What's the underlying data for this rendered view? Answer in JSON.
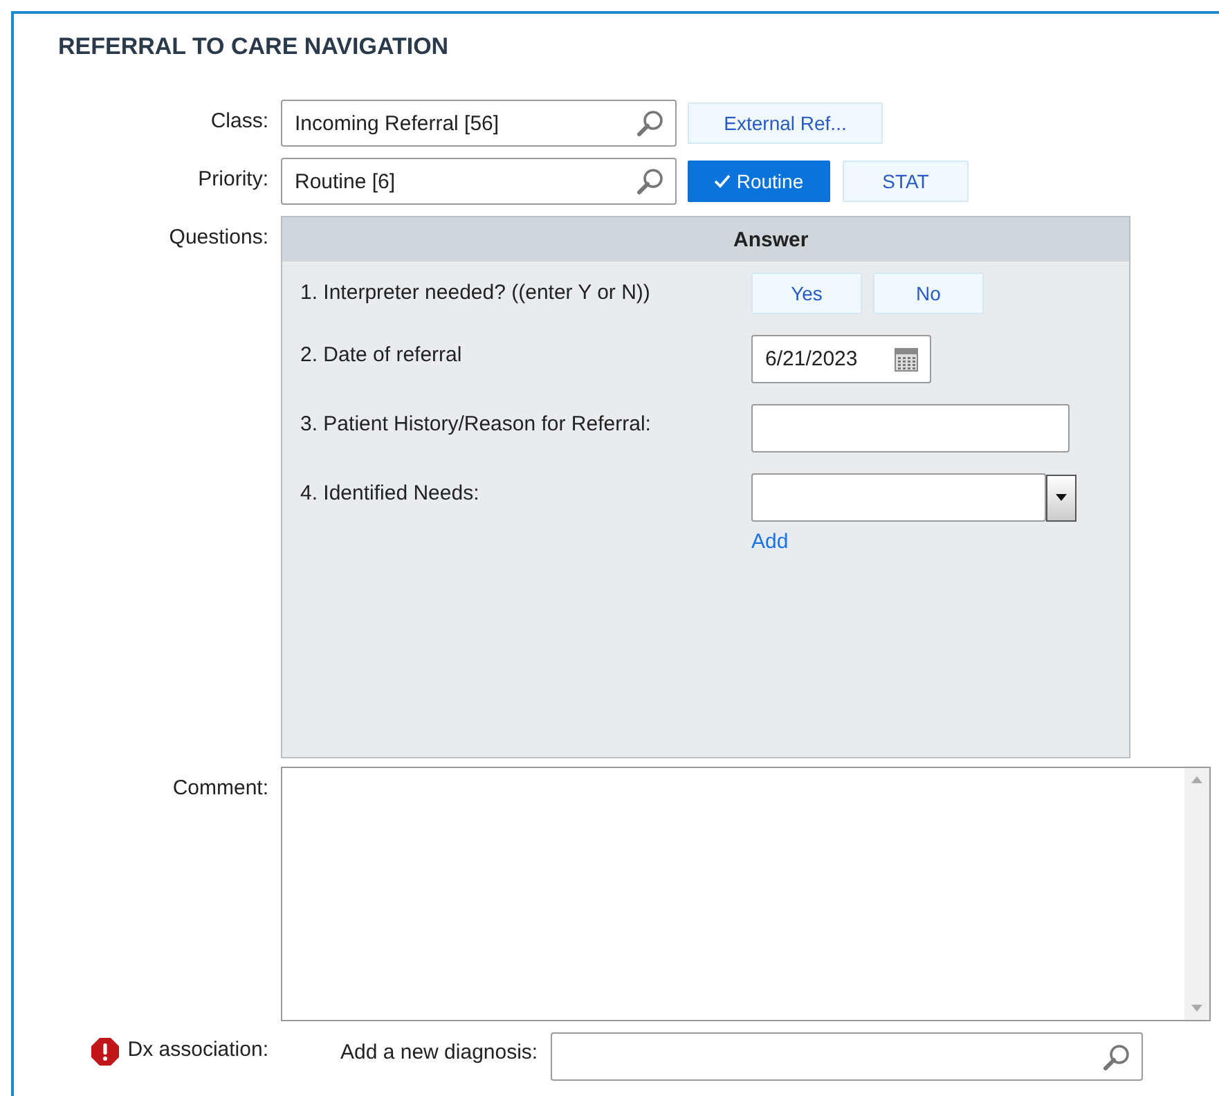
{
  "title": "REFERRAL TO CARE NAVIGATION",
  "fields": [
    {
      "label": "Class:",
      "value": "Incoming Referral [56]",
      "options": [
        {
          "label": "External Ref...",
          "selected": false
        }
      ]
    },
    {
      "label": "Priority:",
      "value": "Routine [6]",
      "options": [
        {
          "label": "Routine",
          "selected": true
        },
        {
          "label": "STAT",
          "selected": false
        }
      ]
    }
  ],
  "questions": {
    "label": "Questions:",
    "header": "Answer",
    "items": [
      {
        "kind": "choice",
        "text": "1. Interpreter needed? ((enter Y or N))",
        "options": [
          {
            "label": "Yes",
            "selected": false
          },
          {
            "label": "No",
            "selected": false
          }
        ]
      },
      {
        "kind": "date",
        "text": "2. Date of referral",
        "value": "6/21/2023"
      },
      {
        "kind": "text",
        "text": "3. Patient History/Reason for Referral:"
      },
      {
        "kind": "dropdown",
        "text": "4. Identified Needs:",
        "link": "Add"
      }
    ]
  },
  "comment": {
    "label": "Comment:"
  },
  "dx": {
    "label": "Dx association:",
    "required": true,
    "prompt": "Add a new diagnosis:"
  }
}
